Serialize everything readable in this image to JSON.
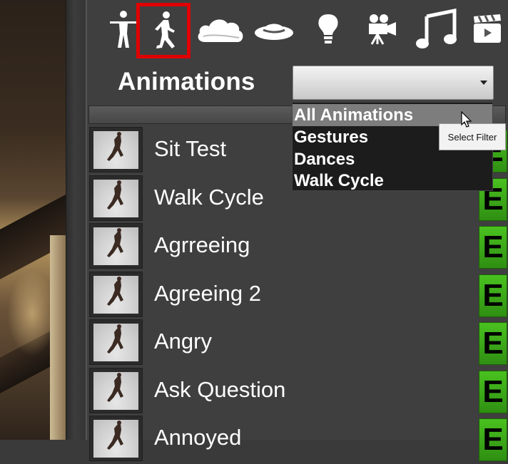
{
  "toolbar": {
    "icons": [
      "figure-icon",
      "running-icon",
      "cloud-icon",
      "hat-icon",
      "lightbulb-icon",
      "camera-icon",
      "music-icon",
      "clapperboard-icon"
    ],
    "selected": "running-icon",
    "selected_color": "#e00000"
  },
  "header": {
    "title": "Animations",
    "filter_value": ""
  },
  "dropdown": {
    "options": [
      "All Animations",
      "Gestures",
      "Dances",
      "Walk Cycle"
    ],
    "hovered": "All Animations"
  },
  "tooltip": {
    "text": "Select Filter"
  },
  "list": {
    "items": [
      {
        "label": "Sit Test",
        "button": "E"
      },
      {
        "label": "Walk Cycle",
        "button": "E"
      },
      {
        "label": "Agrreeing",
        "button": "E"
      },
      {
        "label": "Agreeing 2",
        "button": "E"
      },
      {
        "label": "Angry",
        "button": "E"
      },
      {
        "label": "Ask Question",
        "button": "E"
      },
      {
        "label": "Annoyed",
        "button": "E"
      }
    ],
    "button_color": "#3aa818"
  }
}
